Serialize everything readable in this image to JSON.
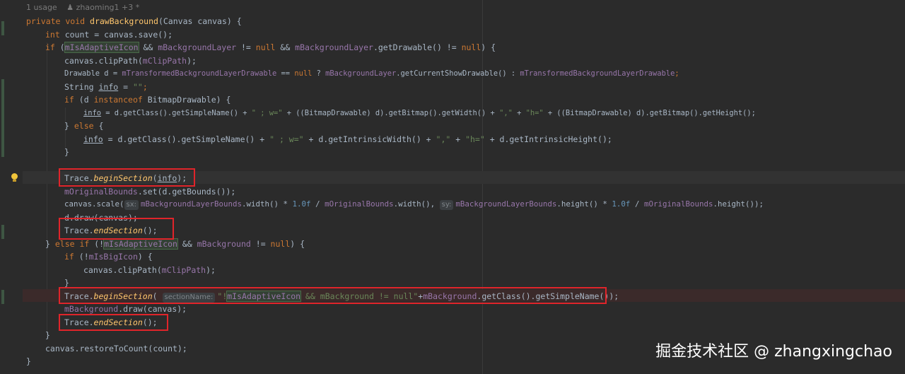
{
  "header": {
    "usage_hint": "1 usage",
    "author_hint": "zhaoming1 +3 *"
  },
  "code": {
    "l1": {
      "kw": "private void ",
      "name": "drawBackground",
      "rest": "(Canvas canvas) {"
    },
    "l2": {
      "kw": "int ",
      "rest": "count = canvas.save();"
    },
    "l3": {
      "a": "if (",
      "b": "mIsAdaptiveIcon",
      "c": " && ",
      "d": "mBackgroundLayer",
      "e": " != ",
      "f": "null",
      "g": " && ",
      "h": "mBackgroundLayer",
      "i": ".getDrawable() != ",
      "j": "null",
      "k": ") {"
    },
    "l4": {
      "a": "canvas.clipPath(",
      "b": "mClipPath",
      "c": ");"
    },
    "l5": {
      "a": "Drawable d = ",
      "b": "mTransformedBackgroundLayerDrawable",
      "c": " == ",
      "d": "null",
      "e": " ? ",
      "f": "mBackgroundLayer",
      "g": ".getCurrentShowDrawable() : ",
      "h": "mTransformedBackgroundLayerDrawable",
      "i": ";"
    },
    "l6": {
      "a": "String ",
      "b": "info",
      "c": " = ",
      "d": "\"\"",
      "e": ";"
    },
    "l7": {
      "a": "if ",
      "b": "(d ",
      "c": "instanceof",
      "d": " BitmapDrawable) {"
    },
    "l8": {
      "a": "info",
      "b": " = d.getClass().getSimpleName() + ",
      "c": "\" ; w=\"",
      "d": " + ((BitmapDrawable) d).getBitmap().getWidth() + ",
      "e": "\",\"",
      "f": " + ",
      "g": "\"h=\"",
      "h": " + ((BitmapDrawable) d).getBitmap().getHeight();"
    },
    "l9": {
      "a": "} ",
      "b": "else",
      "c": " {"
    },
    "l10": {
      "a": "info",
      "b": " = d.getClass().getSimpleName() + ",
      "c": "\" ; w=\"",
      "d": " + d.getIntrinsicWidth() + ",
      "e": "\",\"",
      "f": " + ",
      "g": "\"h=\"",
      "h": " + d.getIntrinsicHeight();"
    },
    "l11": "}",
    "l12": {
      "a": "Trace.",
      "b": "beginSection",
      "c": "(",
      "d": "info",
      "e": ");"
    },
    "l13": {
      "a": "mOriginalBounds",
      "b": ".set(d.getBounds());"
    },
    "l14": {
      "a": "canvas.scale(",
      "hint1": "sx:",
      "b": "mBackgroundLayerBounds",
      "c": ".width() * ",
      "d": "1.0f",
      "e": " / ",
      "f": "mOriginalBounds",
      "g": ".width(), ",
      "hint2": "sy:",
      "h": "mBackgroundLayerBounds",
      "i": ".height() * ",
      "j": "1.0f",
      "k": " / ",
      "l": "mOriginalBounds",
      "m": ".height());"
    },
    "l15": {
      "a": "d.draw(canvas);"
    },
    "l16": {
      "a": "Trace.",
      "b": "endSection",
      "c": "();"
    },
    "l17": {
      "a": "} ",
      "b": "else if",
      "c": " (!",
      "d": "mIsAdaptiveIcon",
      "e": " && ",
      "f": "mBackground",
      "g": " != ",
      "h": "null",
      "i": ") {"
    },
    "l18": {
      "a": "if",
      "b": " (!",
      "c": "mIsBigIcon",
      "d": ") {"
    },
    "l19": {
      "a": "canvas.clipPath(",
      "b": "mClipPath",
      "c": ");"
    },
    "l20": "}",
    "l21": {
      "a": "Trace.",
      "b": "beginSection",
      "c": "( ",
      "hint": "sectionName:",
      "d": "\"!",
      "e": "mIsAdaptiveIcon",
      "f": " && mBackground != null\"",
      "g": "+",
      "h": "mBackground",
      "i": ".getClass().getSimpleName());"
    },
    "l22": {
      "a": "mBackground",
      "b": ".draw(canvas);"
    },
    "l23": {
      "a": "Trace.",
      "b": "endSection",
      "c": "();"
    },
    "l24": "}",
    "l25": {
      "a": "canvas.restoreToCount(count);"
    },
    "l26": "}"
  },
  "watermark": "掘金技术社区 @ zhangxingchao",
  "colors": {
    "background": "#2b2b2b",
    "keyword": "#cc7832",
    "method": "#ffc66d",
    "field": "#9876aa",
    "string": "#6a8759",
    "number": "#6897bb",
    "highlight_box": "#e0242a"
  }
}
